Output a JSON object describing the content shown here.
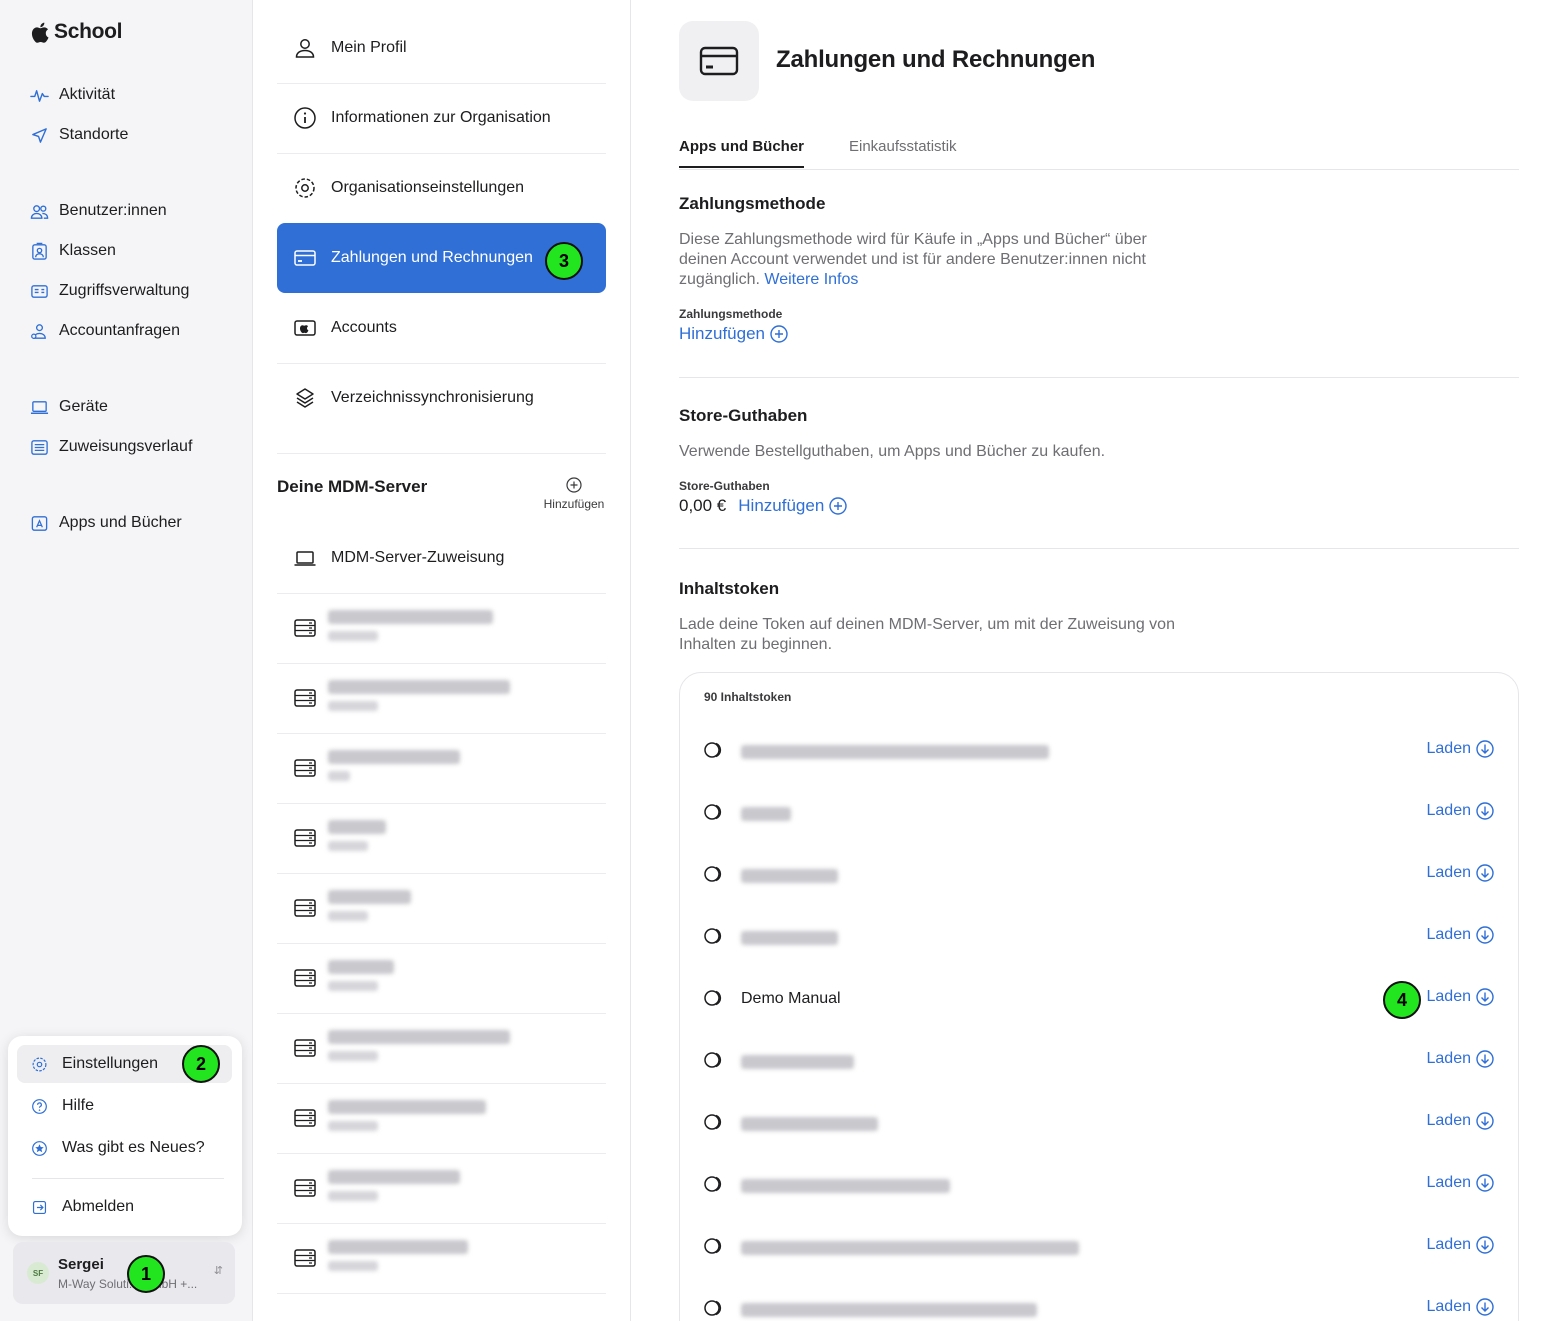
{
  "app": {
    "brand": "School"
  },
  "sidebar": {
    "items": [
      {
        "label": "Aktivität",
        "icon": "activity-icon"
      },
      {
        "label": "Standorte",
        "icon": "location-icon"
      },
      {
        "label": "Benutzer:innen",
        "icon": "users-icon"
      },
      {
        "label": "Klassen",
        "icon": "classes-icon"
      },
      {
        "label": "Zugriffsverwaltung",
        "icon": "id-card-icon"
      },
      {
        "label": "Accountanfragen",
        "icon": "account-request-icon"
      },
      {
        "label": "Geräte",
        "icon": "laptop-icon"
      },
      {
        "label": "Zuweisungsverlauf",
        "icon": "list-icon"
      },
      {
        "label": "Apps und Bücher",
        "icon": "app-store-icon"
      }
    ]
  },
  "popover": {
    "items": [
      {
        "label": "Einstellungen",
        "icon": "gear-icon"
      },
      {
        "label": "Hilfe",
        "icon": "help-icon"
      },
      {
        "label": "Was gibt es Neues?",
        "icon": "star-icon"
      },
      {
        "label": "Abmelden",
        "icon": "logout-icon"
      }
    ]
  },
  "user": {
    "initials": "SF",
    "name": "Sergei",
    "org": "M-Way Soluti... GmbH +..."
  },
  "settings_menu": {
    "items": [
      {
        "label": "Mein Profil",
        "icon": "person-icon"
      },
      {
        "label": "Informationen zur Organisation",
        "icon": "info-icon"
      },
      {
        "label": "Organisationseinstellungen",
        "icon": "gear-icon"
      },
      {
        "label": "Zahlungen und Rechnungen",
        "icon": "credit-card-icon"
      },
      {
        "label": "Accounts",
        "icon": "apple-account-icon"
      },
      {
        "label": "Verzeichnissynchronisierung",
        "icon": "sync-icon"
      }
    ],
    "mdm_title": "Deine MDM-Server",
    "mdm_add": "Hinzufügen",
    "mdm_assignment": "MDM-Server-Zuweisung"
  },
  "page": {
    "title": "Zahlungen und Rechnungen",
    "tabs": [
      {
        "label": "Apps und Bücher"
      },
      {
        "label": "Einkaufsstatistik"
      }
    ],
    "payment": {
      "title": "Zahlungsmethode",
      "desc": "Diese Zahlungsmethode wird für Käufe in „Apps und Bücher“ über deinen Account verwendet und ist für andere Benutzer:innen nicht zugänglich.",
      "more": "Weitere Infos",
      "field_label": "Zahlungsmethode",
      "add": "Hinzufügen"
    },
    "store_credit": {
      "title": "Store-Guthaben",
      "desc": "Verwende Bestellguthaben, um Apps und Bücher zu kaufen.",
      "field_label": "Store-Guthaben",
      "amount": "0,00 €",
      "add": "Hinzufügen"
    },
    "tokens": {
      "title": "Inhaltstoken",
      "desc": "Lade deine Token auf deinen MDM-Server, um mit der Zuweisung von Inhalten zu beginnen.",
      "count": "90 Inhaltstoken",
      "load_label": "Laden",
      "visible_name": "Demo Manual"
    }
  },
  "markers": [
    "1",
    "2",
    "3",
    "4"
  ],
  "colors": {
    "accent": "#2f6fd6",
    "marker": "#22e51f",
    "sidebar_bg": "#f5f5f7"
  }
}
